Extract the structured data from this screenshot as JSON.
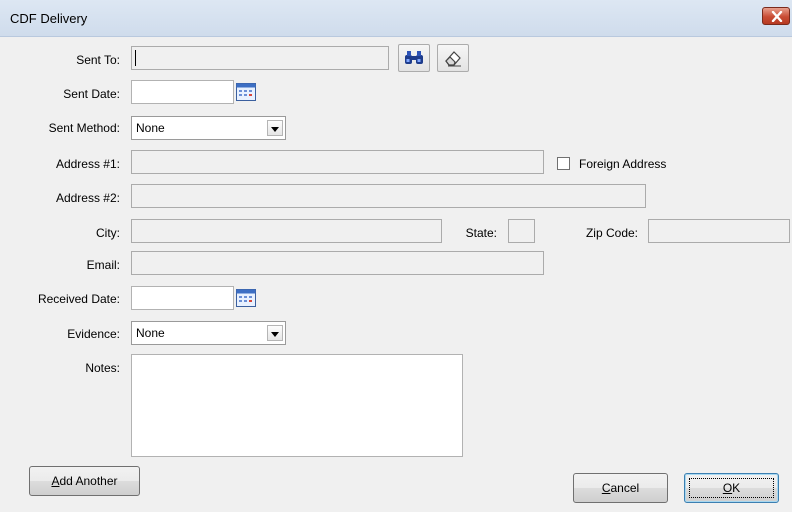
{
  "window": {
    "title": "CDF Delivery"
  },
  "icons": {
    "close": "close-icon",
    "search": "binoculars-icon",
    "clear": "eraser-icon",
    "calendar": "calendar-icon"
  },
  "fields": {
    "sent_to": {
      "label": "Sent To:",
      "value": ""
    },
    "sent_date": {
      "label": "Sent Date:",
      "value": ""
    },
    "sent_method": {
      "label": "Sent Method:",
      "value": "None"
    },
    "address1": {
      "label": "Address #1:",
      "value": ""
    },
    "foreign_address": {
      "label": "Foreign Address",
      "checked": false
    },
    "address2": {
      "label": "Address #2:",
      "value": ""
    },
    "city": {
      "label": "City:",
      "value": ""
    },
    "state": {
      "label": "State:",
      "value": ""
    },
    "zip": {
      "label": "Zip Code:",
      "value": ""
    },
    "email": {
      "label": "Email:",
      "value": ""
    },
    "received_date": {
      "label": "Received Date:",
      "value": ""
    },
    "evidence": {
      "label": "Evidence:",
      "value": "None"
    },
    "notes": {
      "label": "Notes:",
      "value": ""
    }
  },
  "buttons": {
    "add_another": {
      "mnemonic": "A",
      "rest": "dd Another"
    },
    "cancel": {
      "mnemonic": "C",
      "rest": "ancel"
    },
    "ok": {
      "mnemonic": "O",
      "rest": "K"
    }
  }
}
